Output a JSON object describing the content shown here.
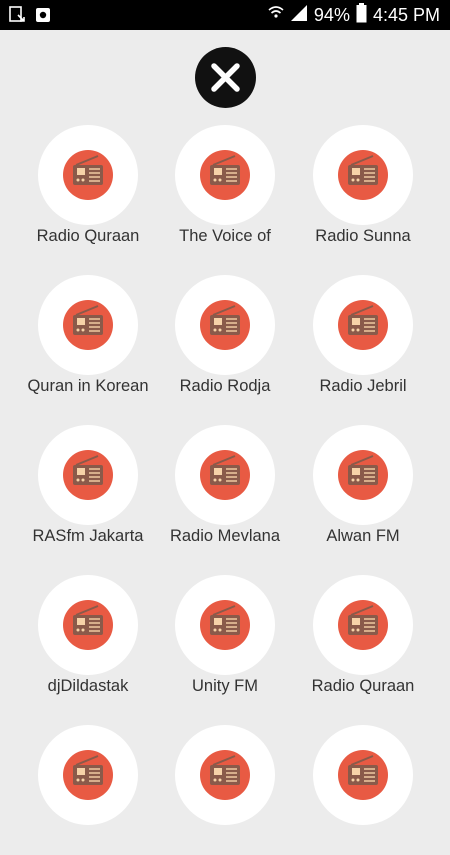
{
  "status_bar": {
    "battery": "94%",
    "time": "4:45 PM"
  },
  "close_button": {
    "icon": "close-icon"
  },
  "stations": [
    "Radio Quraan",
    "The Voice of",
    "Radio Sunna",
    "Quran in Korean",
    "Radio Rodja",
    "Radio Jebril",
    "RASfm Jakarta",
    "Radio Mevlana",
    "Alwan FM",
    "djDildastak",
    "Unity FM",
    "Radio Quraan",
    "",
    "",
    ""
  ],
  "colors": {
    "icon_bg": "#e85a43",
    "radio_body": "#8a5a4a",
    "status_bar": "#000000"
  }
}
